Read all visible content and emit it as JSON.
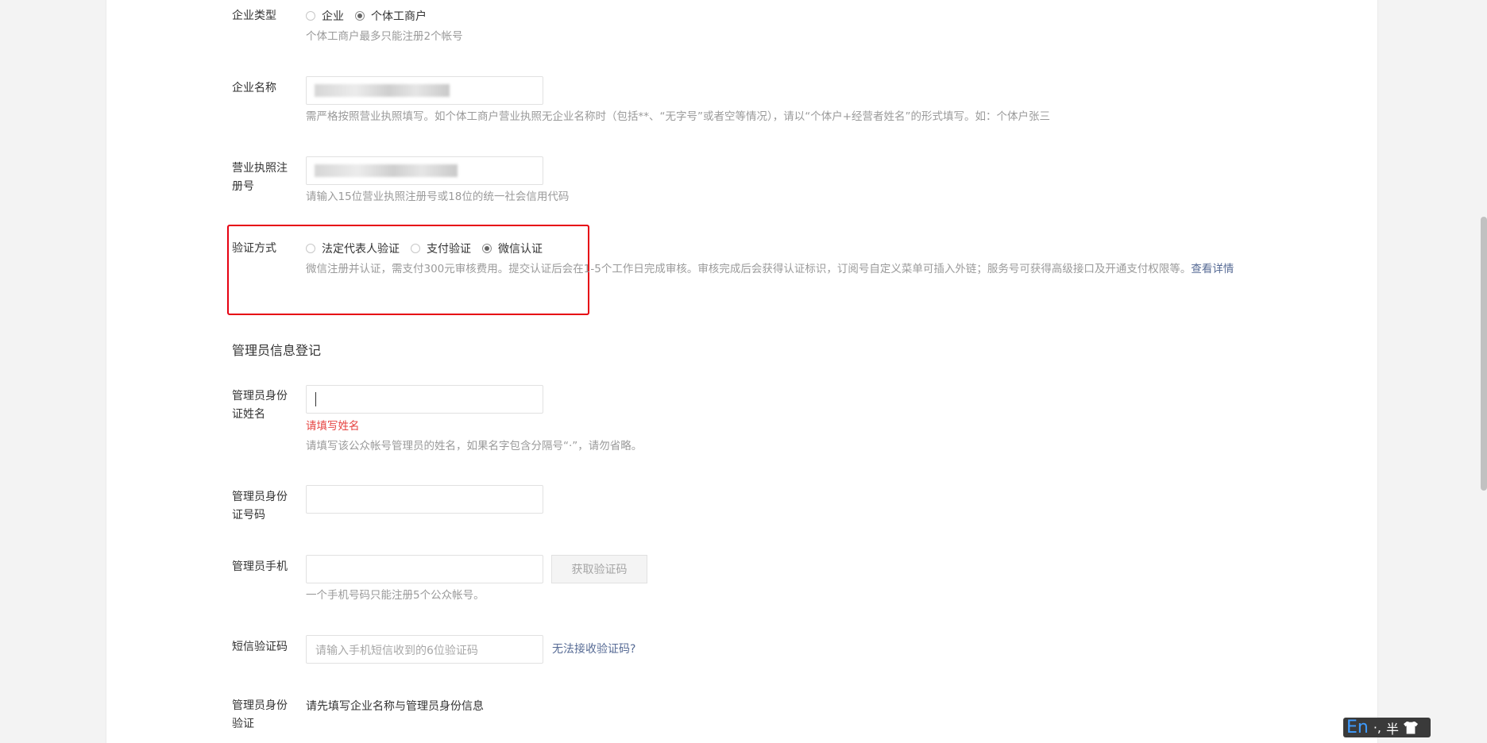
{
  "company_type": {
    "label": "企业类型",
    "options": [
      "企业",
      "个体工商户"
    ],
    "selected": "个体工商户",
    "tip": "个体工商户最多只能注册2个帐号"
  },
  "company_name": {
    "label": "企业名称",
    "tip": "需严格按照营业执照填写。如个体工商户营业执照无企业名称时（包括**、“无字号”或者空等情况），请以“个体户+经营者姓名”的形式填写。如：个体户张三"
  },
  "license_no": {
    "label": "营业执照注册号",
    "tip": "请输入15位营业执照注册号或18位的统一社会信用代码"
  },
  "verify_method": {
    "label": "验证方式",
    "options": [
      "法定代表人验证",
      "支付验证",
      "微信认证"
    ],
    "selected": "微信认证",
    "tip": "微信注册并认证，需支付300元审核费用。提交认证后会在1-5个工作日完成审核。审核完成后会获得认证标识，订阅号自定义菜单可插入外链；服务号可获得高级接口及开通支付权限等。",
    "tip_link": "查看详情"
  },
  "admin_section": {
    "title": "管理员信息登记"
  },
  "admin_name": {
    "label": "管理员身份证姓名",
    "error": "请填写姓名",
    "tip": "请填写该公众帐号管理员的姓名，如果名字包含分隔号“·”，请勿省略。"
  },
  "admin_id": {
    "label": "管理员身份证号码"
  },
  "admin_phone": {
    "label": "管理员手机",
    "button": "获取验证码",
    "tip": "一个手机号码只能注册5个公众帐号。"
  },
  "sms_code": {
    "label": "短信验证码",
    "placeholder": "请输入手机短信收到的6位验证码",
    "link": "无法接收验证码?"
  },
  "admin_verify": {
    "label": "管理员身份验证",
    "text": "请先填写企业名称与管理员身份信息"
  },
  "ime": {
    "lang": "En",
    "punct": "·,",
    "width": "半"
  }
}
